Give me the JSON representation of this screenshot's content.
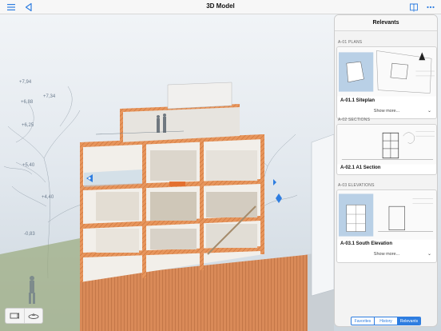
{
  "topbar": {
    "title": "3D Model",
    "icons": [
      "menu-icon",
      "back-arrow-icon",
      "book-icon",
      "more-icon"
    ]
  },
  "viewport": {
    "level_labels": [
      "+7,94",
      "+6,88",
      "+7,34",
      "+6,25",
      "+5,40",
      "+4,40",
      "-0,83"
    ],
    "view_buttons": [
      "camera-view-icon",
      "orbit-view-icon"
    ]
  },
  "relevants": {
    "title": "Relevants",
    "sections": [
      {
        "header": "A-01 PLANS",
        "caption": "A-01.1 Siteplan",
        "show_more": "Show more..."
      },
      {
        "header": "A-02 SECTIONS",
        "caption": "A-02.1 A1 Section"
      },
      {
        "header": "A-03 ELEVATIONS",
        "caption": "A-03.1 South Elevation",
        "show_more": "Show more..."
      }
    ],
    "tabs": [
      "Favorites",
      "History",
      "Relevants"
    ],
    "active_tab": "Relevants"
  },
  "colors": {
    "accent": "#2e7de0",
    "section_orange": "#e08a4a",
    "facade_wood": "#d98a58"
  }
}
